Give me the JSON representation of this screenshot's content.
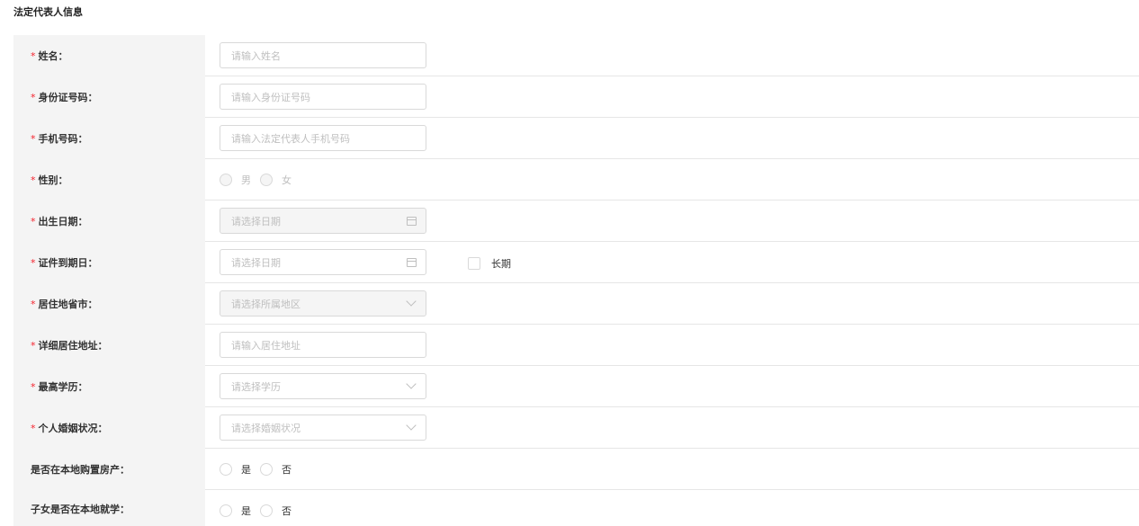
{
  "section": {
    "title": "法定代表人信息"
  },
  "fields": {
    "name": {
      "label": "姓名：",
      "placeholder": "请输入姓名"
    },
    "id_number": {
      "label": "身份证号码：",
      "placeholder": "请输入身份证号码"
    },
    "phone": {
      "label": "手机号码：",
      "placeholder": "请输入法定代表人手机号码"
    },
    "gender": {
      "label": "性别：",
      "options": [
        "男",
        "女"
      ]
    },
    "birth_date": {
      "label": "出生日期：",
      "placeholder": "请选择日期"
    },
    "id_expiry": {
      "label": "证件到期日：",
      "placeholder": "请选择日期",
      "long_term_label": "长期"
    },
    "residence_region": {
      "label": "居住地省市：",
      "placeholder": "请选择所属地区"
    },
    "address": {
      "label": "详细居住地址：",
      "placeholder": "请输入居住地址"
    },
    "education": {
      "label": "最高学历：",
      "placeholder": "请选择学历"
    },
    "marital": {
      "label": "个人婚姻状况：",
      "placeholder": "请选择婚姻状况"
    },
    "local_property": {
      "label": "是否在本地购置房产：",
      "options": [
        "是",
        "否"
      ]
    },
    "children_school": {
      "label": "子女是否在本地就学：",
      "options": [
        "是",
        "否"
      ]
    }
  },
  "required_mark": "*",
  "colors": {
    "required": "#f5222d",
    "label_bg": "#f4f4f4",
    "border": "#d9d9d9",
    "placeholder": "#bfbfbf"
  }
}
